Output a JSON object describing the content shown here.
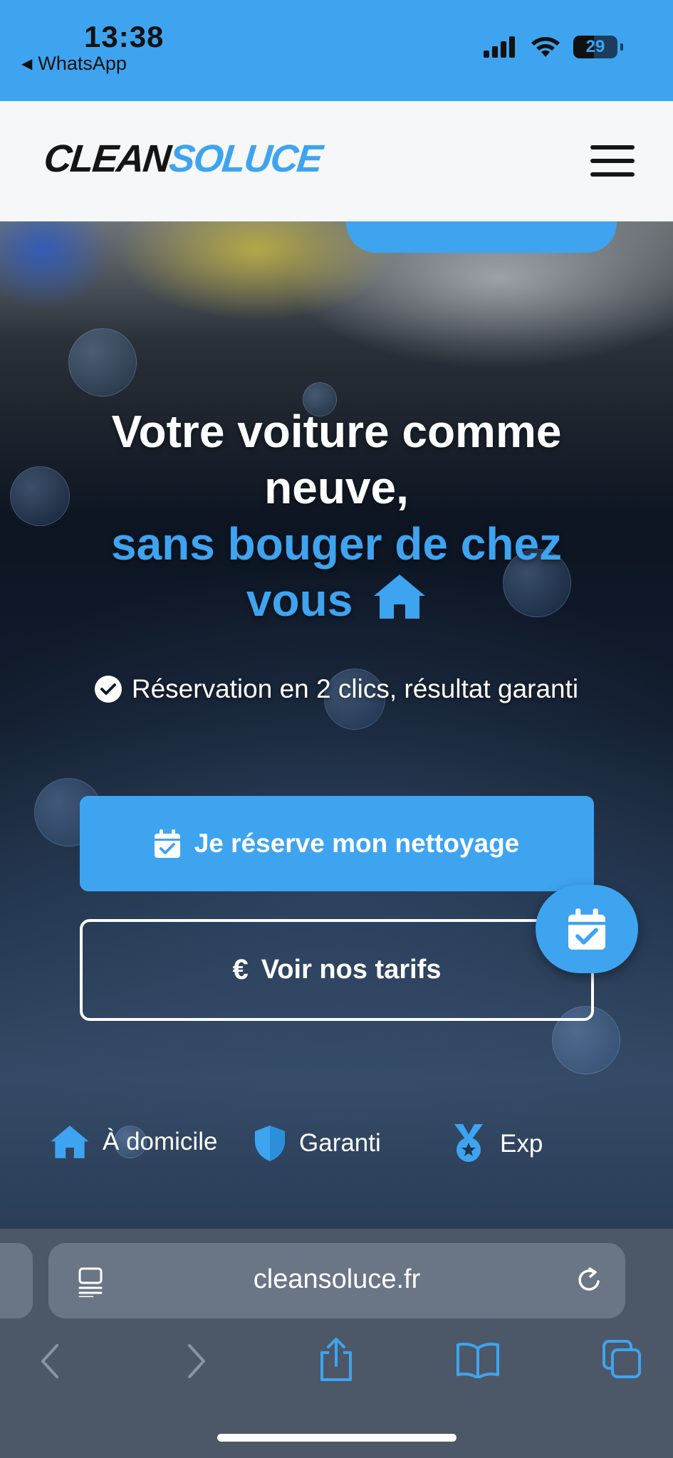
{
  "status_bar": {
    "time": "13:38",
    "back_app": "WhatsApp",
    "battery": "29",
    "icons": [
      "signal-icon",
      "wifi-icon",
      "battery-icon"
    ]
  },
  "header": {
    "logo_part1": "CLEAN",
    "logo_part2": "SOLUCE",
    "menu_icon": "hamburger-icon"
  },
  "hero": {
    "headline_white": "Votre voiture comme neuve,",
    "headline_blue": "sans bouger de chez vous",
    "feature": "Réservation en 2 clics, résultat garanti",
    "primary_cta": "Je réserve mon nettoyage",
    "secondary_cta": "Voir nos tarifs",
    "secondary_symbol": "€",
    "trust_items": [
      {
        "label": "À domicile",
        "icon": "home-icon"
      },
      {
        "label": "Garanti",
        "icon": "shield-icon"
      },
      {
        "label": "Exp",
        "icon": "medal-icon"
      }
    ]
  },
  "browser": {
    "url": "cleansoluce.fr",
    "toolbar": [
      "back-icon",
      "forward-icon",
      "share-icon",
      "bookmarks-icon",
      "tabs-icon"
    ]
  },
  "colors": {
    "accent": "#3ea4f0",
    "header_bg": "#f6f7f8",
    "safari_bg": "#4c5868"
  }
}
